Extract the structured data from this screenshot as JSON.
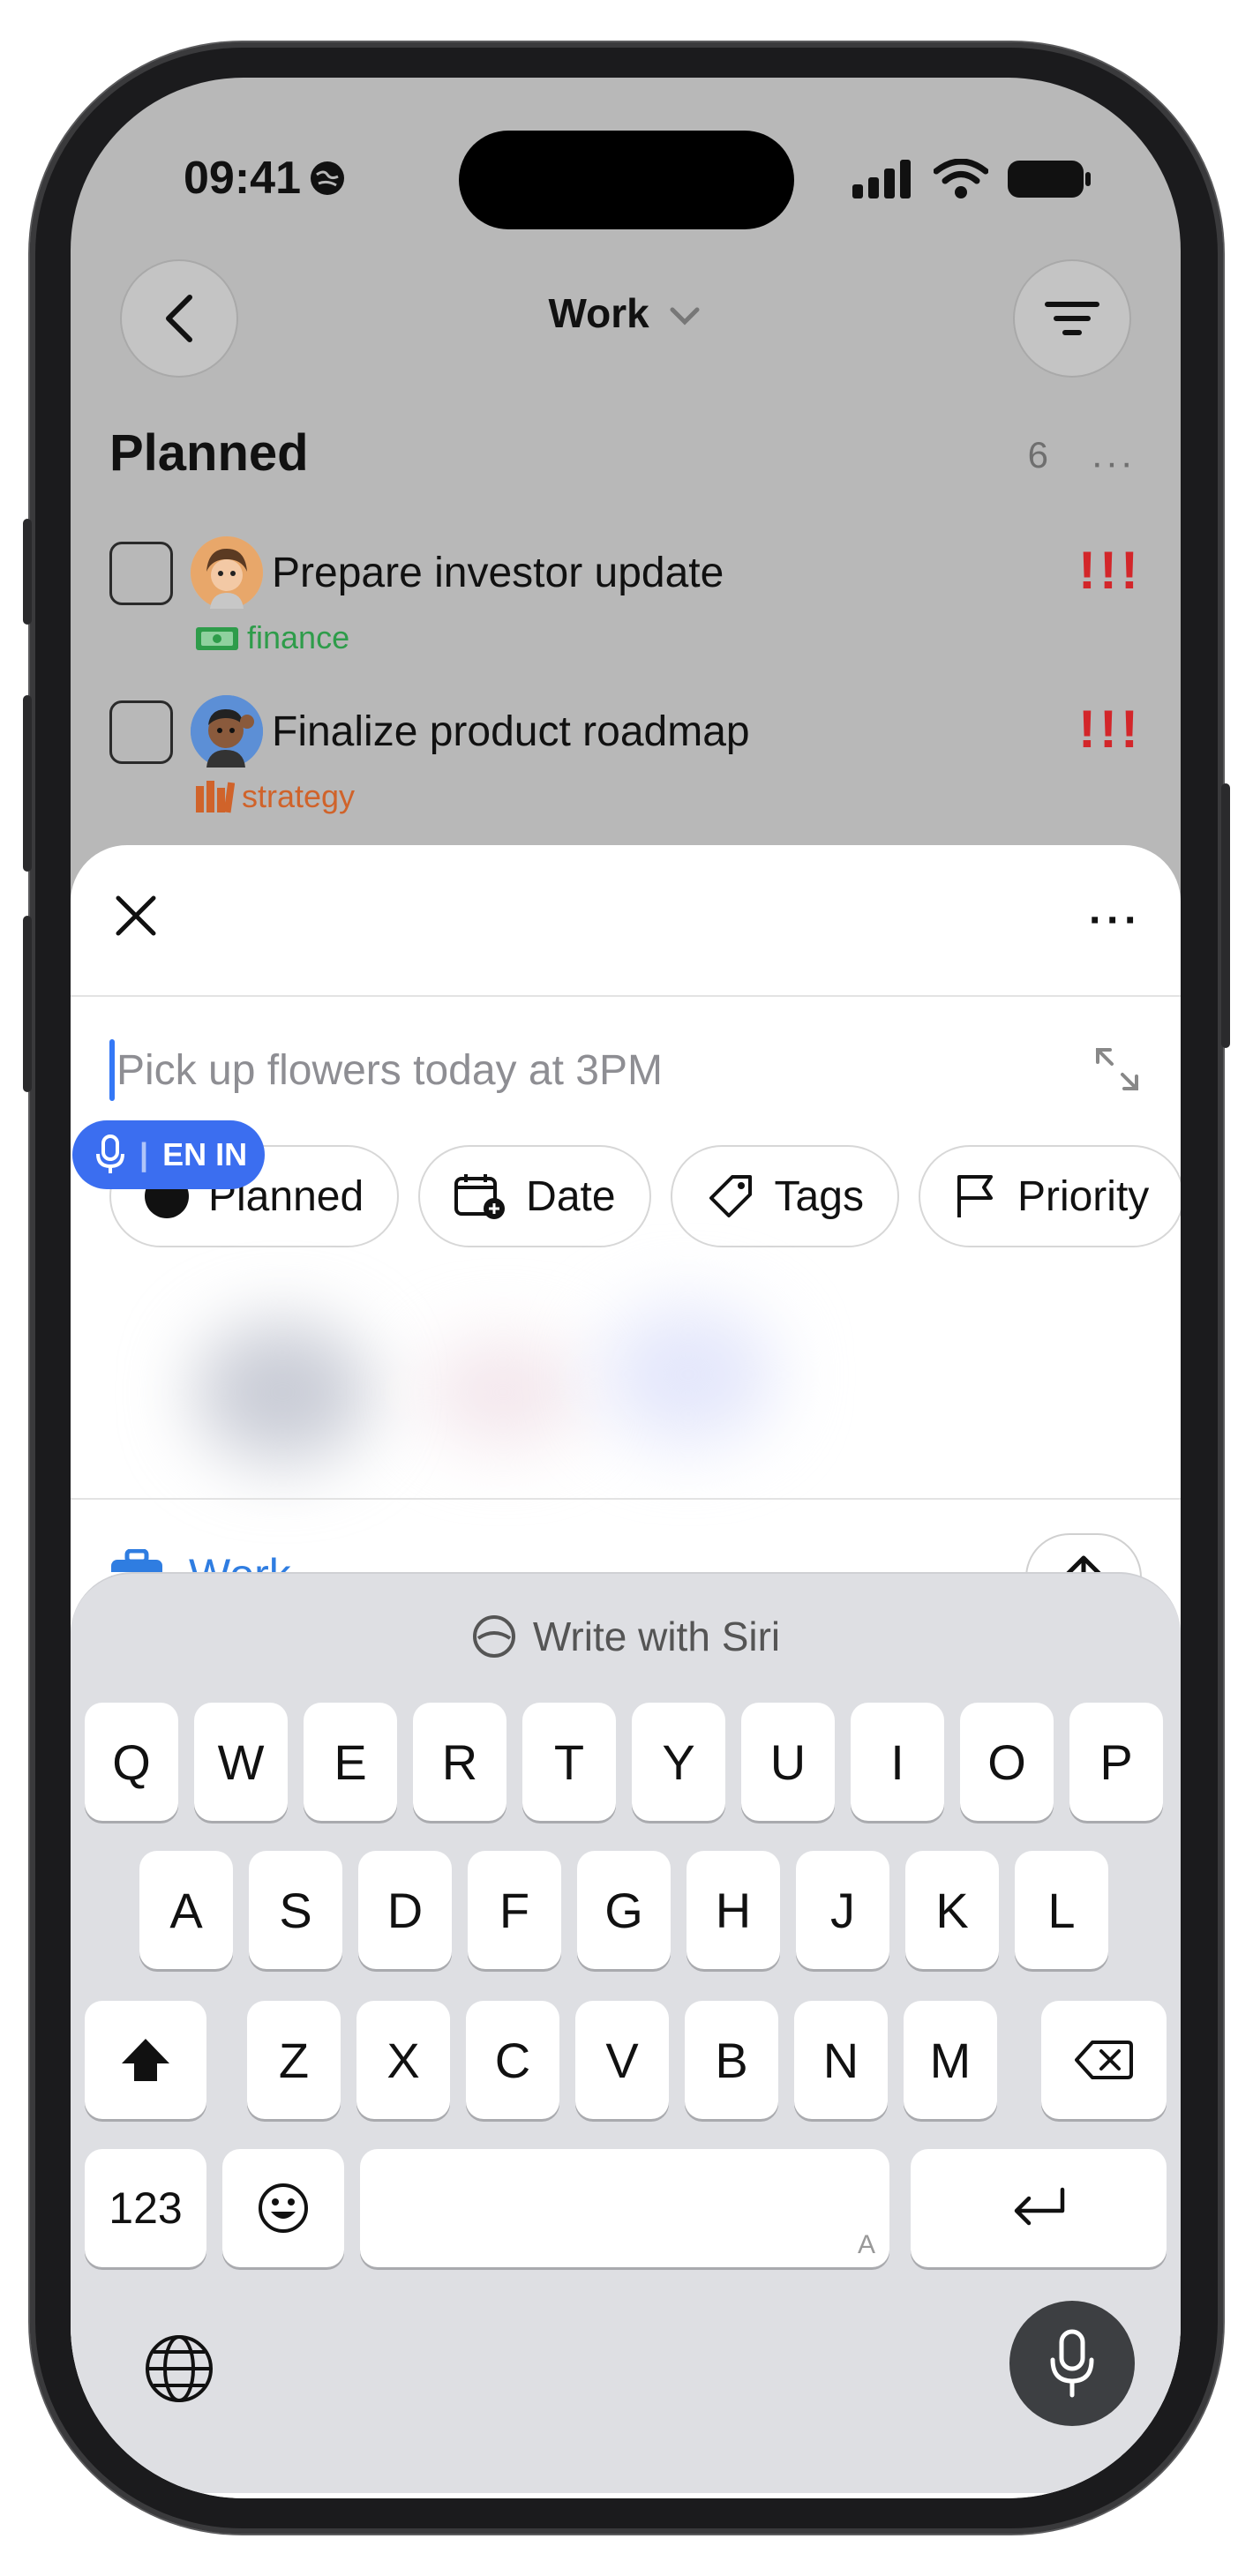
{
  "status_bar": {
    "time": "09:41"
  },
  "nav": {
    "title": "Work"
  },
  "section": {
    "title": "Planned",
    "count": "6",
    "more": "···"
  },
  "tasks": [
    {
      "title": "Prepare investor update",
      "tag": "finance",
      "tag_color": "#2e9c4a",
      "priority": "!!!"
    },
    {
      "title": "Finalize product roadmap",
      "tag": "strategy",
      "tag_color": "#d0632a",
      "priority": "!!!"
    }
  ],
  "sheet": {
    "more": "···",
    "placeholder": "Pick up flowers today at 3PM",
    "voice_pill": "EN IN",
    "chips": [
      "Planned",
      "Date",
      "Tags",
      "Priority"
    ],
    "list_name": "Work"
  },
  "keyboard": {
    "siri_label": "Write with Siri",
    "row1": [
      "Q",
      "W",
      "E",
      "R",
      "T",
      "Y",
      "U",
      "I",
      "O",
      "P"
    ],
    "row2": [
      "A",
      "S",
      "D",
      "F",
      "G",
      "H",
      "J",
      "K",
      "L"
    ],
    "row3": [
      "Z",
      "X",
      "C",
      "V",
      "B",
      "N",
      "M"
    ],
    "numbers_key": "123",
    "space_hint": "A"
  },
  "colors": {
    "accent_blue": "#2f7de1",
    "priority_red": "#d3262a"
  }
}
